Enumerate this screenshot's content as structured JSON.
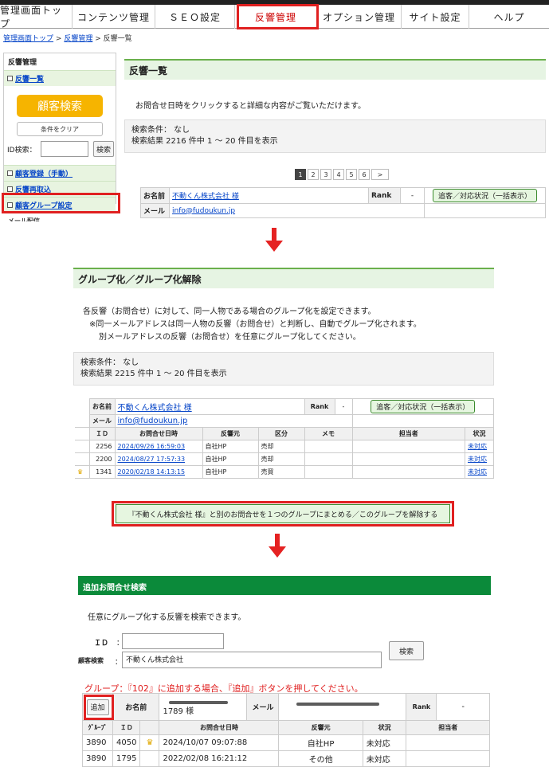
{
  "nav": {
    "tabs": [
      "管理画面トップ",
      "コンテンツ管理",
      "ＳＥＯ設定",
      "反響管理",
      "オプション管理",
      "サイト設定",
      "ヘルプ"
    ]
  },
  "breadcrumb": {
    "home": "管理画面トップ",
    "section": "反響管理",
    "current": "反響一覧",
    "sep": ">"
  },
  "sidebar": {
    "header": "反響管理",
    "item_list": "反響一覧",
    "search_button": "顧客検索",
    "clear_button": "条件をクリア",
    "id_label": "ID検索：",
    "id_search_button": "検索",
    "item_register": "顧客登録（手動）",
    "item_reimport": "反響再取込",
    "item_group": "顧客グループ設定",
    "item_cut": "メール配信"
  },
  "list": {
    "title": "反響一覧",
    "hint": "お問合せ日時をクリックすると詳細な内容がご覧いただけます。",
    "cond": "検索条件：  なし",
    "result": "検索結果 2216 件中   1 ～ 20   件目を表示",
    "pages": [
      "1",
      "2",
      "3",
      "4",
      "5",
      "6",
      ">"
    ],
    "name_label": "お名前",
    "name_value": "不動くん株式会社 様",
    "rank_label": "Rank",
    "rank_value": "-",
    "status_button": "追客／対応状況（一括表示）",
    "mail_label": "メール",
    "mail_value": "info@fudoukun.jp"
  },
  "group": {
    "title": "グループ化／グループ化解除",
    "desc1": "各反響（お問合せ）に対して、同一人物である場合のグループ化を設定できます。",
    "desc2": "※同一メールアドレスは同一人物の反響（お問合せ）と判断し、自動でグループ化されます。",
    "desc3": "別メールアドレスの反響（お問合せ）を任意にグループ化してください。",
    "cond": "検索条件：  なし",
    "result": "検索結果 2215 件中   1 ～ 20   件目を表示",
    "name_label": "お名前",
    "name_value": "不動くん株式会社 様",
    "rank_label": "Rank",
    "rank_value": "-",
    "status_button": "追客／対応状況（一括表示）",
    "mail_label": "メール",
    "mail_value": "info@fudoukun.jp",
    "headers": [
      "ＩＤ",
      "お問合せ日時",
      "反響元",
      "区分",
      "メモ",
      "担当者",
      "状況"
    ],
    "rows": [
      {
        "id": "2256",
        "date": "2024/09/26 16:59:03",
        "source": "自社HP",
        "kind": "売却",
        "memo": "",
        "staff": "",
        "status": "未対応",
        "crown": ""
      },
      {
        "id": "2200",
        "date": "2024/08/27 17:57:33",
        "source": "自社HP",
        "kind": "売却",
        "memo": "",
        "staff": "",
        "status": "未対応",
        "crown": ""
      },
      {
        "id": "1341",
        "date": "2020/02/18 14:13:15",
        "source": "自社HP",
        "kind": "売買",
        "memo": "",
        "staff": "",
        "status": "未対応",
        "crown": "♛"
      }
    ],
    "merge_button": "『不動くん株式会社 様』と別のお問合せを１つのグループにまとめる／このグループを解除する"
  },
  "add": {
    "title": "追加お問合せ検索",
    "desc": "任意にグループ化する反響を検索できます。",
    "id_label": "ＩＤ",
    "colon": "：",
    "customer_label": "顧客検索",
    "customer_value": "不動くん株式会社",
    "search_button": "検索",
    "notice": "グループ：『102』に追加する場合、『追加』ボタンを押してください。",
    "add_button": "追加",
    "name_label": "お名前",
    "name_value": "1789 様",
    "mail_label": "メール",
    "rank_label": "Rank",
    "rank_value": "-",
    "headers": [
      "ｸﾞﾙｰﾌﾟ",
      "ＩＤ",
      "",
      "お問合せ日時",
      "反響元",
      "状況",
      "担当者"
    ],
    "rows": [
      {
        "group": "3890",
        "id": "4050",
        "crown": "♛",
        "date": "2024/10/07 09:07:88",
        "source": "自社HP",
        "status": "未対応",
        "staff": ""
      },
      {
        "group": "3890",
        "id": "1795",
        "crown": "",
        "date": "2022/02/08 16:21:12",
        "source": "その他",
        "status": "未対応",
        "staff": ""
      }
    ]
  },
  "colors": {
    "highlight": "#e02020",
    "accent_green": "#0b8a3a",
    "orange": "#f6b400"
  }
}
